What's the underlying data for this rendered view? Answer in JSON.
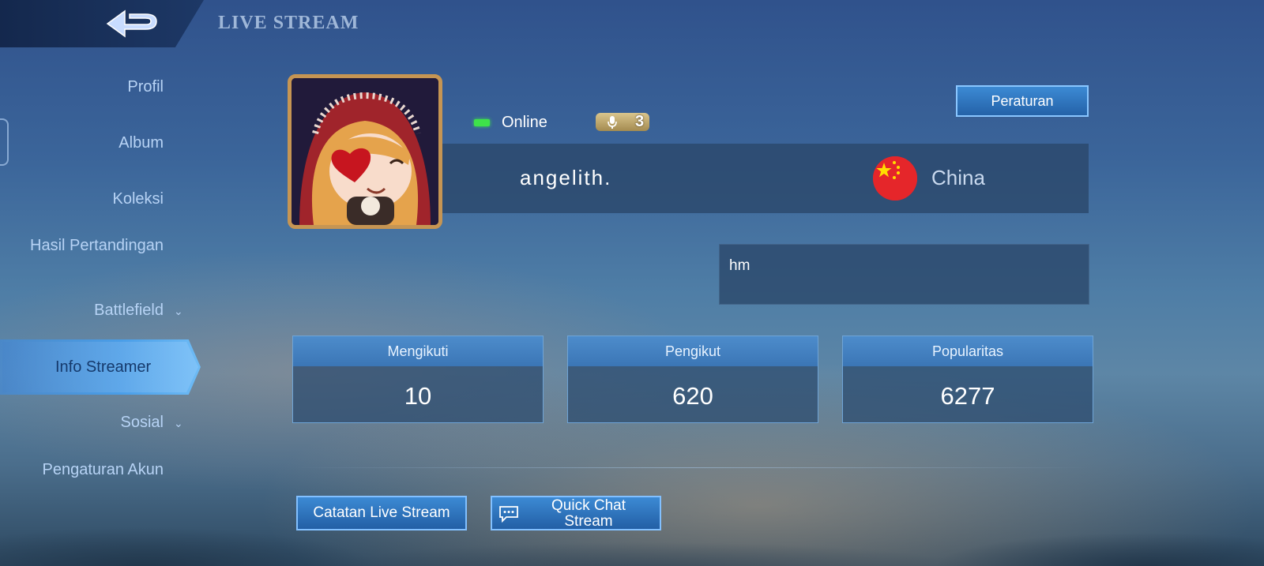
{
  "header": {
    "title": "LIVE STREAM",
    "back_icon": "back-arrow-icon"
  },
  "sidebar": {
    "items": [
      {
        "label": "Profil"
      },
      {
        "label": "Album"
      },
      {
        "label": "Koleksi"
      },
      {
        "label": "Hasil Pertandingan"
      },
      {
        "label": "Battlefield",
        "has_dropdown": true
      },
      {
        "label": "Info Streamer",
        "active": true
      },
      {
        "label": "Sosial",
        "has_dropdown": true
      },
      {
        "label": "Pengaturan Akun"
      }
    ]
  },
  "profile": {
    "status": "Online",
    "status_color": "#3ee34a",
    "mic_level": "3",
    "name": "angelith.",
    "country": "China",
    "bio": "hm"
  },
  "rules_button": {
    "label": "Peraturan"
  },
  "stats": [
    {
      "label": "Mengikuti",
      "value": "10"
    },
    {
      "label": "Pengikut",
      "value": "620"
    },
    {
      "label": "Popularitas",
      "value": "6277"
    }
  ],
  "actions": {
    "history_label": "Catatan Live Stream",
    "quick_chat_label": "Quick Chat Stream"
  },
  "colors": {
    "accent": "#3c8ad4",
    "avatar_border": "#c69553"
  }
}
